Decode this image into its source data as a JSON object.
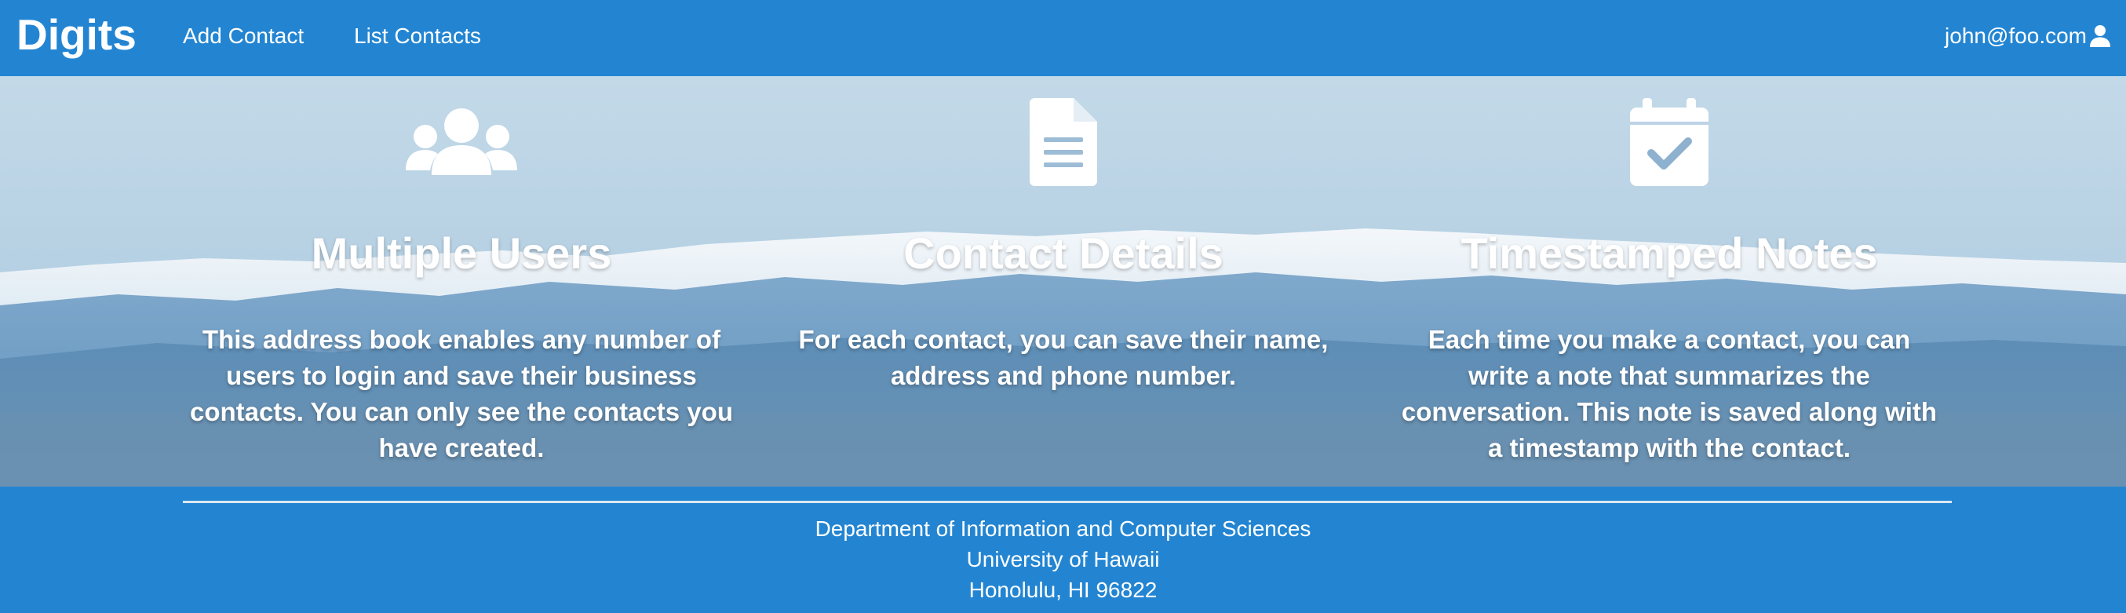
{
  "navbar": {
    "brand": "Digits",
    "links": [
      {
        "label": "Add Contact"
      },
      {
        "label": "List Contacts"
      }
    ],
    "user": "john@foo.com",
    "user_icon": "user-icon"
  },
  "hero": {
    "features": [
      {
        "icon": "users-icon",
        "title": "Multiple Users",
        "text": "This address book enables any number of users to login and save their business contacts. You can only see the contacts you have created."
      },
      {
        "icon": "file-text-icon",
        "title": "Contact Details",
        "text": "For each contact, you can save their name, address and phone number."
      },
      {
        "icon": "calendar-check-icon",
        "title": "Timestamped Notes",
        "text": "Each time you make a contact, you can write a note that summarizes the conversation. This note is saved along with a timestamp with the contact."
      }
    ]
  },
  "footer": {
    "line1": "Department of Information and Computer Sciences",
    "line2": "University of Hawaii",
    "line3": "Honolulu, HI 96822"
  },
  "colors": {
    "primary": "#2385d2",
    "text": "#ffffff"
  }
}
